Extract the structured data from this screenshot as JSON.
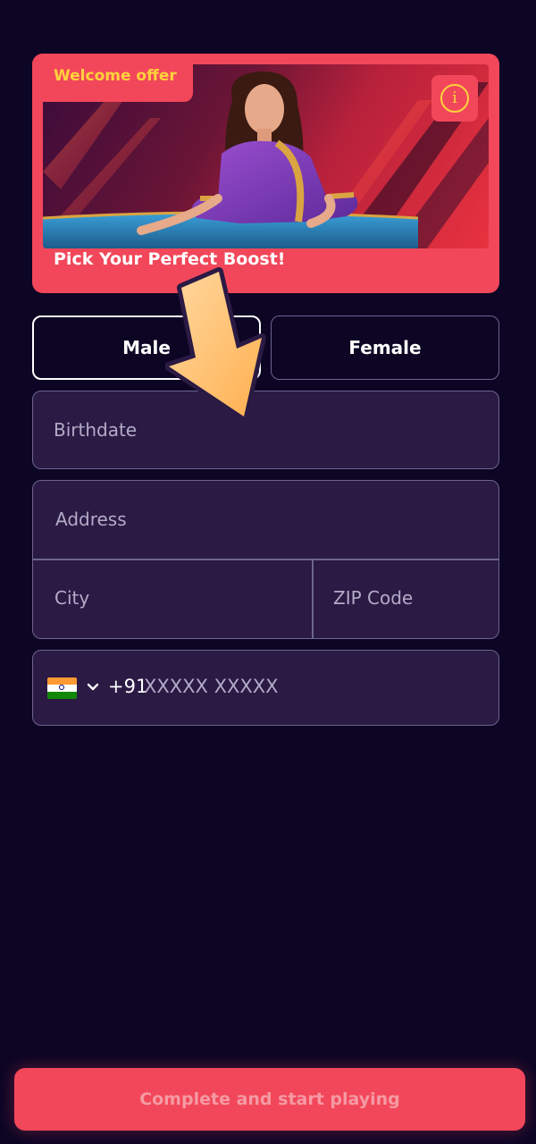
{
  "promo": {
    "badge": "Welcome offer",
    "title": "Pick Your Perfect Boost!",
    "info_icon": "info-icon"
  },
  "gender": {
    "male_label": "Male",
    "female_label": "Female",
    "selected": "Male"
  },
  "form": {
    "birthdate_placeholder": "Birthdate",
    "address_placeholder": "Address",
    "city_placeholder": "City",
    "zip_placeholder": "ZIP Code",
    "phone": {
      "country_flag": "india-flag-icon",
      "dial_code": "+91",
      "placeholder": "XXXXX XXXXX"
    }
  },
  "cta": {
    "label": "Complete and start playing"
  },
  "colors": {
    "background": "#0d0524",
    "accent": "#f2475a",
    "badge_text": "#ffd23c",
    "field_bg": "#2a1a44",
    "field_border": "#6d6590"
  }
}
